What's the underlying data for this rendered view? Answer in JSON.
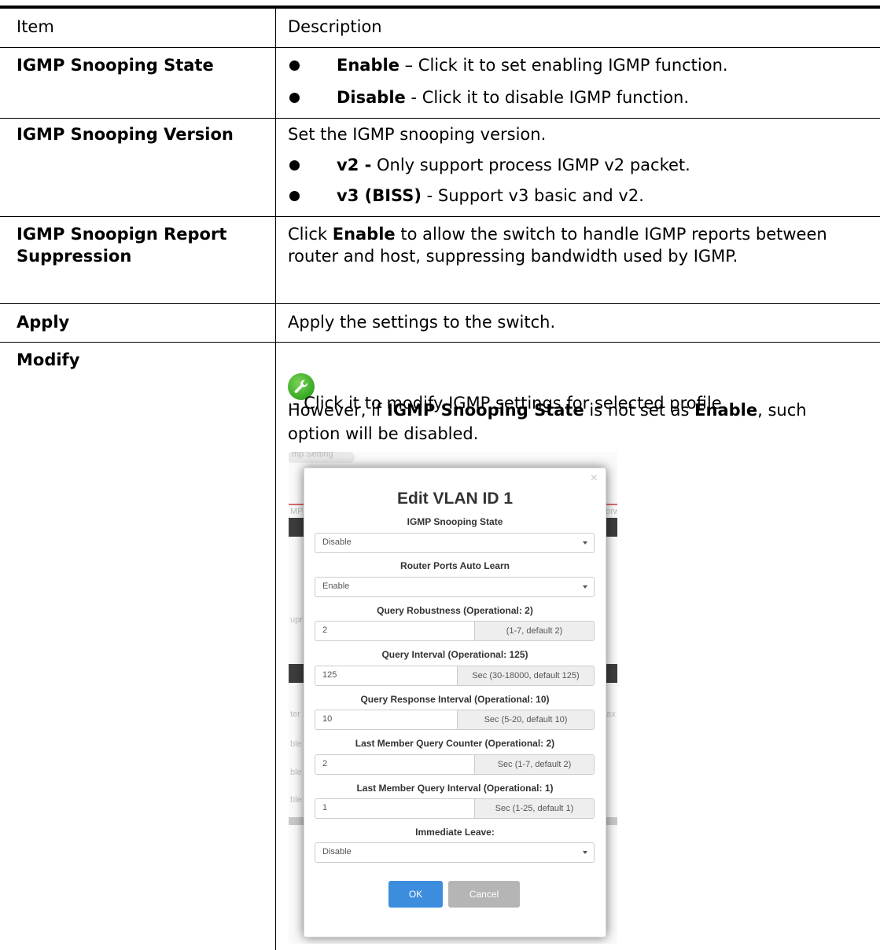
{
  "header": {
    "item": "Item",
    "description": "Description"
  },
  "rows": {
    "state": {
      "item": "IGMP Snooping State",
      "bullet1_bold": "Enable",
      "bullet1_rest": " – Click it to set enabling IGMP function.",
      "bullet2_bold": "Disable",
      "bullet2_rest": " - Click it to disable IGMP function."
    },
    "version": {
      "item": "IGMP Snooping Version",
      "intro": "Set the IGMP snooping version.",
      "bullet1_bold": "v2 -",
      "bullet1_rest": " Only support process IGMP v2 packet.",
      "bullet2_bold": "v3 (BISS)",
      "bullet2_rest": " - Support v3 basic and v2."
    },
    "suppression": {
      "item_line1": "IGMP Snoopign Report",
      "item_line2": "Suppression",
      "pre": "Click ",
      "bold": "Enable",
      "post": " to allow the switch to handle IGMP reports between router and host, suppressing bandwidth used by IGMP."
    },
    "apply": {
      "item": "Apply",
      "desc": "Apply the settings to the switch."
    },
    "modify": {
      "item": "Modify",
      "icon": "wrench-icon",
      "line1": "- Click it to modify IGMP settings for selected profile.",
      "line2_pre": "However, if ",
      "line2_bold1": "IGMP Snooping State",
      "line2_mid": " is not set as ",
      "line2_bold2": "Enable",
      "line2_post": ", such",
      "line3": "option will be disabled."
    }
  },
  "modal": {
    "title": "Edit VLAN ID 1",
    "close": "×",
    "fields": {
      "state": {
        "label": "IGMP Snooping State",
        "value": "Disable"
      },
      "autolearn": {
        "label": "Router Ports Auto Learn",
        "value": "Enable"
      },
      "robustness": {
        "label": "Query Robustness (Operational: 2)",
        "value": "2",
        "hint": "(1-7, default 2)"
      },
      "interval": {
        "label": "Query Interval (Operational: 125)",
        "value": "125",
        "hint": "Sec (30-18000, default 125)"
      },
      "response": {
        "label": "Query Response Interval (Operational: 10)",
        "value": "10",
        "hint": "Sec (5-20, default 10)"
      },
      "lmq_counter": {
        "label": "Last Member Query Counter (Operational: 2)",
        "value": "2",
        "hint": "Sec (1-7, default 2)"
      },
      "lmq_interval": {
        "label": "Last Member Query Interval (Operational: 1)",
        "value": "1",
        "hint": "Sec (1-25, default 1)"
      },
      "immediate": {
        "label": "Immediate Leave:",
        "value": "Disable"
      }
    },
    "ok": "OK",
    "cancel": "Cancel"
  },
  "background_fragments": {
    "pill": "mp Setting",
    "left1": "MP",
    "right1": "orw",
    "left2": "upr",
    "left3": "ter",
    "right3": "ax",
    "left4": "ble",
    "left5": "ble",
    "left6": "ble"
  },
  "colors": {
    "ok_button": "#3c8dde",
    "cancel_button": "#b5b5b5",
    "icon_green": "#3fae2a"
  }
}
